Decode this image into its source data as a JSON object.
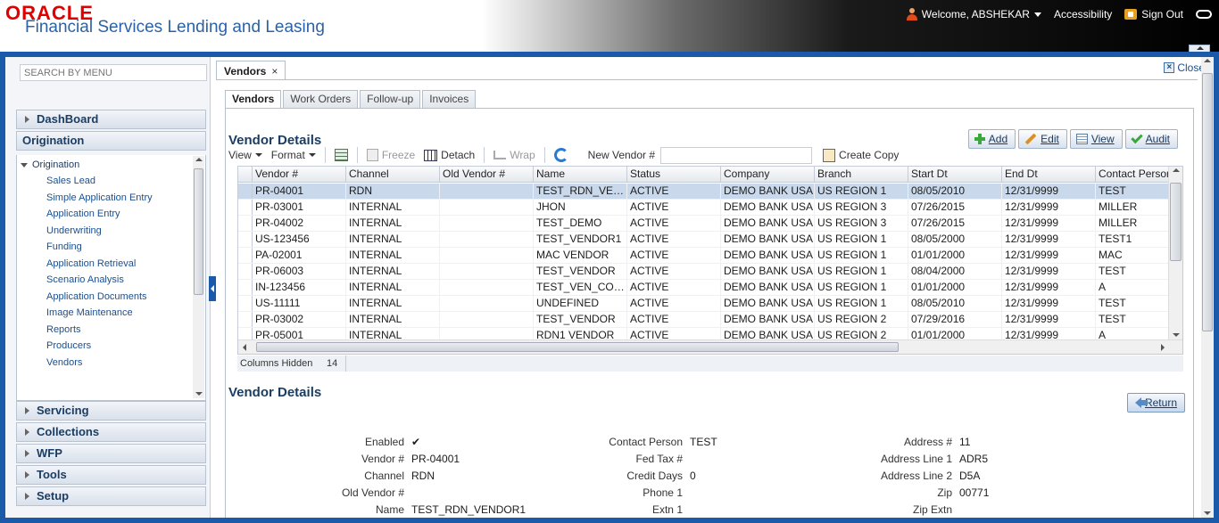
{
  "header": {
    "oracle": "ORACLE",
    "product": "Financial Services Lending and Leasing",
    "welcome": "Welcome, ABSHEKAR",
    "accessibility": "Accessibility",
    "sign_out": "Sign Out"
  },
  "left_menu": {
    "search_placeholder": "SEARCH BY MENU",
    "dashboard": "DashBoard",
    "origination": "Origination",
    "tree_root": "Origination",
    "items": [
      "Sales Lead",
      "Simple Application Entry",
      "Application Entry",
      "Underwriting",
      "Funding",
      "Application Retrieval",
      "Scenario Analysis",
      "Application Documents",
      "Image Maintenance",
      "Reports",
      "Producers",
      "Vendors"
    ],
    "sections": [
      "Servicing",
      "Collections",
      "WFP",
      "Tools",
      "Setup"
    ]
  },
  "doc_tab": {
    "label": "Vendors",
    "close": "×"
  },
  "close_link": "Close",
  "inner_tabs": [
    "Vendors",
    "Work Orders",
    "Follow-up",
    "Invoices"
  ],
  "section_title": "Vendor Details",
  "actions": {
    "add": "Add",
    "edit": "Edit",
    "view": "View",
    "audit": "Audit"
  },
  "toolbar": {
    "view": "View",
    "format": "Format",
    "freeze": "Freeze",
    "detach": "Detach",
    "wrap": "Wrap",
    "new_vendor_label": "New Vendor #",
    "create_copy": "Create Copy"
  },
  "grid": {
    "columns": [
      "Vendor #",
      "Channel",
      "Old Vendor #",
      "Name",
      "Status",
      "Company",
      "Branch",
      "Start Dt",
      "End Dt",
      "Contact Person"
    ],
    "rows": [
      [
        "PR-04001",
        "RDN",
        "",
        "TEST_RDN_VENDO...",
        "ACTIVE",
        "DEMO BANK USA",
        "US REGION 1",
        "08/05/2010",
        "12/31/9999",
        "TEST"
      ],
      [
        "PR-03001",
        "INTERNAL",
        "",
        "JHON",
        "ACTIVE",
        "DEMO BANK USA",
        "US REGION 3",
        "07/26/2015",
        "12/31/9999",
        "MILLER"
      ],
      [
        "PR-04002",
        "INTERNAL",
        "",
        "TEST_DEMO",
        "ACTIVE",
        "DEMO BANK USA",
        "US REGION 3",
        "07/26/2015",
        "12/31/9999",
        "MILLER"
      ],
      [
        "US-123456",
        "INTERNAL",
        "",
        "TEST_VENDOR1",
        "ACTIVE",
        "DEMO BANK USA",
        "US REGION 1",
        "08/05/2000",
        "12/31/9999",
        "TEST1"
      ],
      [
        "PA-02001",
        "INTERNAL",
        "",
        "MAC VENDOR",
        "ACTIVE",
        "DEMO BANK USA",
        "US REGION 1",
        "01/01/2000",
        "12/31/9999",
        "MAC"
      ],
      [
        "PR-06003",
        "INTERNAL",
        "",
        "TEST_VENDOR",
        "ACTIVE",
        "DEMO BANK USA",
        "US REGION 1",
        "08/04/2000",
        "12/31/9999",
        "TEST"
      ],
      [
        "IN-123456",
        "INTERNAL",
        "",
        "TEST_VEN_COPY",
        "ACTIVE",
        "DEMO BANK USA",
        "US REGION 1",
        "01/01/2000",
        "12/31/9999",
        "A"
      ],
      [
        "US-11111",
        "INTERNAL",
        "",
        "UNDEFINED",
        "ACTIVE",
        "DEMO BANK USA",
        "US REGION 1",
        "08/05/2010",
        "12/31/9999",
        "TEST"
      ],
      [
        "PR-03002",
        "INTERNAL",
        "",
        "TEST_VENDOR",
        "ACTIVE",
        "DEMO BANK USA",
        "US REGION 2",
        "07/29/2016",
        "12/31/9999",
        "TEST"
      ],
      [
        "PR-05001",
        "INTERNAL",
        "",
        "RDN1 VENDOR",
        "ACTIVE",
        "DEMO BANK USA",
        "US REGION 2",
        "01/01/2000",
        "12/31/9999",
        "A"
      ]
    ],
    "columns_hidden_label": "Columns Hidden",
    "columns_hidden_value": "14"
  },
  "detail": {
    "title": "Vendor Details",
    "return": "Return",
    "col1": [
      {
        "label": "Enabled",
        "value": "✔"
      },
      {
        "label": "Vendor #",
        "value": "PR-04001"
      },
      {
        "label": "Channel",
        "value": "RDN"
      },
      {
        "label": "Old Vendor #",
        "value": ""
      },
      {
        "label": "Name",
        "value": "TEST_RDN_VENDOR1"
      }
    ],
    "col2": [
      {
        "label": "Contact Person",
        "value": "TEST"
      },
      {
        "label": "Fed Tax #",
        "value": ""
      },
      {
        "label": "Credit Days",
        "value": "0"
      },
      {
        "label": "Phone 1",
        "value": ""
      },
      {
        "label": "Extn 1",
        "value": ""
      }
    ],
    "col3": [
      {
        "label": "Address #",
        "value": "11"
      },
      {
        "label": "Address Line 1",
        "value": "ADR5"
      },
      {
        "label": "Address Line 2",
        "value": "D5A"
      },
      {
        "label": "Zip",
        "value": "00771"
      },
      {
        "label": "Zip Extn",
        "value": ""
      }
    ]
  }
}
